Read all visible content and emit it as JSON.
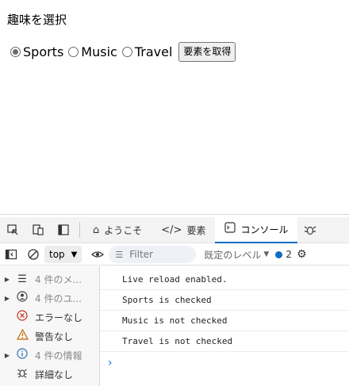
{
  "page": {
    "heading": "趣味を選択",
    "radios": [
      {
        "label": "Sports",
        "checked": true
      },
      {
        "label": "Music",
        "checked": false
      },
      {
        "label": "Travel",
        "checked": false
      }
    ],
    "get_button": "要素を取得"
  },
  "devtools": {
    "tabs": [
      {
        "icon": "home-icon",
        "label": "ようこそ",
        "active": false
      },
      {
        "icon": "code-brackets-icon",
        "label": "要素",
        "active": false
      },
      {
        "icon": "console-icon",
        "label": "コンソール",
        "active": true
      }
    ],
    "toolbar": {
      "context": "top",
      "filter_placeholder": "Filter",
      "levels": "既定のレベル",
      "issues_count": "2"
    },
    "sidebar": [
      {
        "expander": "▶",
        "icon": "list-icon",
        "label": "4 件のメ...",
        "muted": true
      },
      {
        "expander": "▶",
        "icon": "user-circle-icon",
        "label": "4 件のユ...",
        "muted": true
      },
      {
        "expander": "",
        "icon": "error-icon",
        "label": "エラーなし",
        "muted": false
      },
      {
        "expander": "",
        "icon": "warning-icon",
        "label": "警告なし",
        "muted": false
      },
      {
        "expander": "▶",
        "icon": "info-icon",
        "label": "4 件の情報",
        "muted": true
      },
      {
        "expander": "",
        "icon": "bug-icon",
        "label": "詳細なし",
        "muted": false
      }
    ],
    "console_lines": [
      "Live reload enabled.",
      "Sports is checked",
      "Music is not checked",
      "Travel is not checked"
    ],
    "prompt": "›"
  }
}
